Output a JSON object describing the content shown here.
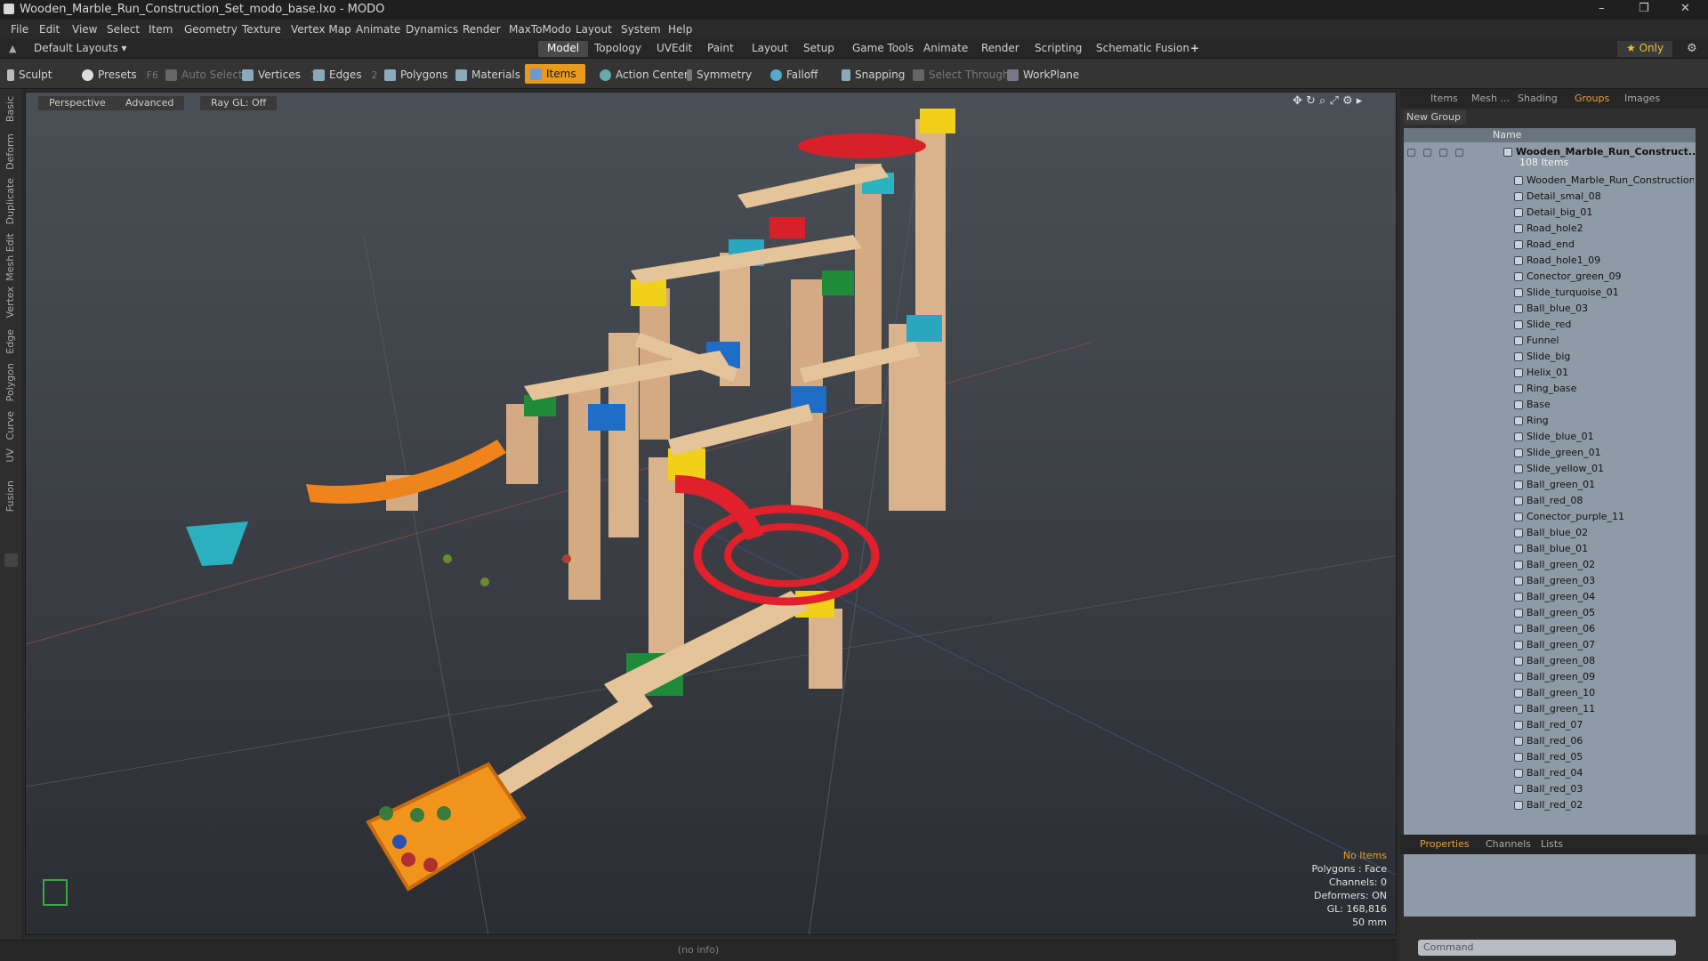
{
  "window": {
    "title": "Wooden_Marble_Run_Construction_Set_modo_base.lxo - MODO",
    "minimize": "–",
    "maximize": "❐",
    "close": "✕"
  },
  "menu": [
    "File",
    "Edit",
    "View",
    "Select",
    "Item",
    "Geometry",
    "Texture",
    "Vertex Map",
    "Animate",
    "Dynamics",
    "Render",
    "MaxToModo",
    "Layout",
    "System",
    "Help"
  ],
  "layout": {
    "selector": "Default Layouts ▾",
    "tabs": [
      "Model",
      "Topology",
      "UVEdit",
      "Paint",
      "Layout",
      "Setup",
      "Game Tools",
      "Animate",
      "Render",
      "Scripting",
      "Schematic Fusion"
    ],
    "add": "+",
    "only": "★ Only"
  },
  "toolbar": {
    "sculpt": "Sculpt",
    "presets": "Presets",
    "presets_key": "F6",
    "auto_select": "Auto Select",
    "vertices": "Vertices",
    "vertices_key": "1",
    "edges": "Edges",
    "edges_key": "2",
    "polygons": "Polygons",
    "materials": "Materials",
    "items": "Items",
    "action_center": "Action Center",
    "symmetry": "Symmetry",
    "falloff": "Falloff",
    "snapping": "Snapping",
    "select_through": "Select Through",
    "workplane": "WorkPlane"
  },
  "left_tabs": [
    "Basic",
    "Deform",
    "Duplicate",
    "Mesh Edit",
    "Vertex",
    "Edge",
    "Polygon",
    "Curve",
    "UV",
    "Fusion"
  ],
  "viewport": {
    "perspective": "Perspective",
    "advanced": "Advanced",
    "raygl": "Ray GL: Off",
    "info": {
      "no_items": "No Items",
      "polygons": "Polygons : Face",
      "channels": "Channels: 0",
      "deformers": "Deformers: ON",
      "gl": "GL: 168,816",
      "focal": "50 mm"
    }
  },
  "status": "(no info)",
  "right_panel": {
    "tabs": [
      "Items",
      "Mesh ...",
      "Shading",
      "Groups",
      "Images"
    ],
    "new_group": "New Group",
    "column_name": "Name",
    "group_name": "Wooden_Marble_Run_Construct...",
    "group_count": "108 Items",
    "items": [
      "Wooden_Marble_Run_Construction ...",
      "Detail_smal_08",
      "Detail_big_01",
      "Road_hole2",
      "Road_end",
      "Road_hole1_09",
      "Conector_green_09",
      "Slide_turquoise_01",
      "Ball_blue_03",
      "Slide_red",
      "Funnel",
      "Slide_big",
      "Helix_01",
      "Ring_base",
      "Base",
      "Ring",
      "Slide_blue_01",
      "Slide_green_01",
      "Slide_yellow_01",
      "Ball_green_01",
      "Ball_red_08",
      "Conector_purple_11",
      "Ball_blue_02",
      "Ball_blue_01",
      "Ball_green_02",
      "Ball_green_03",
      "Ball_green_04",
      "Ball_green_05",
      "Ball_green_06",
      "Ball_green_07",
      "Ball_green_08",
      "Ball_green_09",
      "Ball_green_10",
      "Ball_green_11",
      "Ball_red_07",
      "Ball_red_06",
      "Ball_red_05",
      "Ball_red_04",
      "Ball_red_03",
      "Ball_red_02"
    ],
    "bottom_tabs": [
      "Properties",
      "Channels",
      "Lists"
    ],
    "command_placeholder": "Command"
  },
  "colors": {
    "accent": "#e89a1c",
    "tree_bg": "#8e9aa6"
  }
}
